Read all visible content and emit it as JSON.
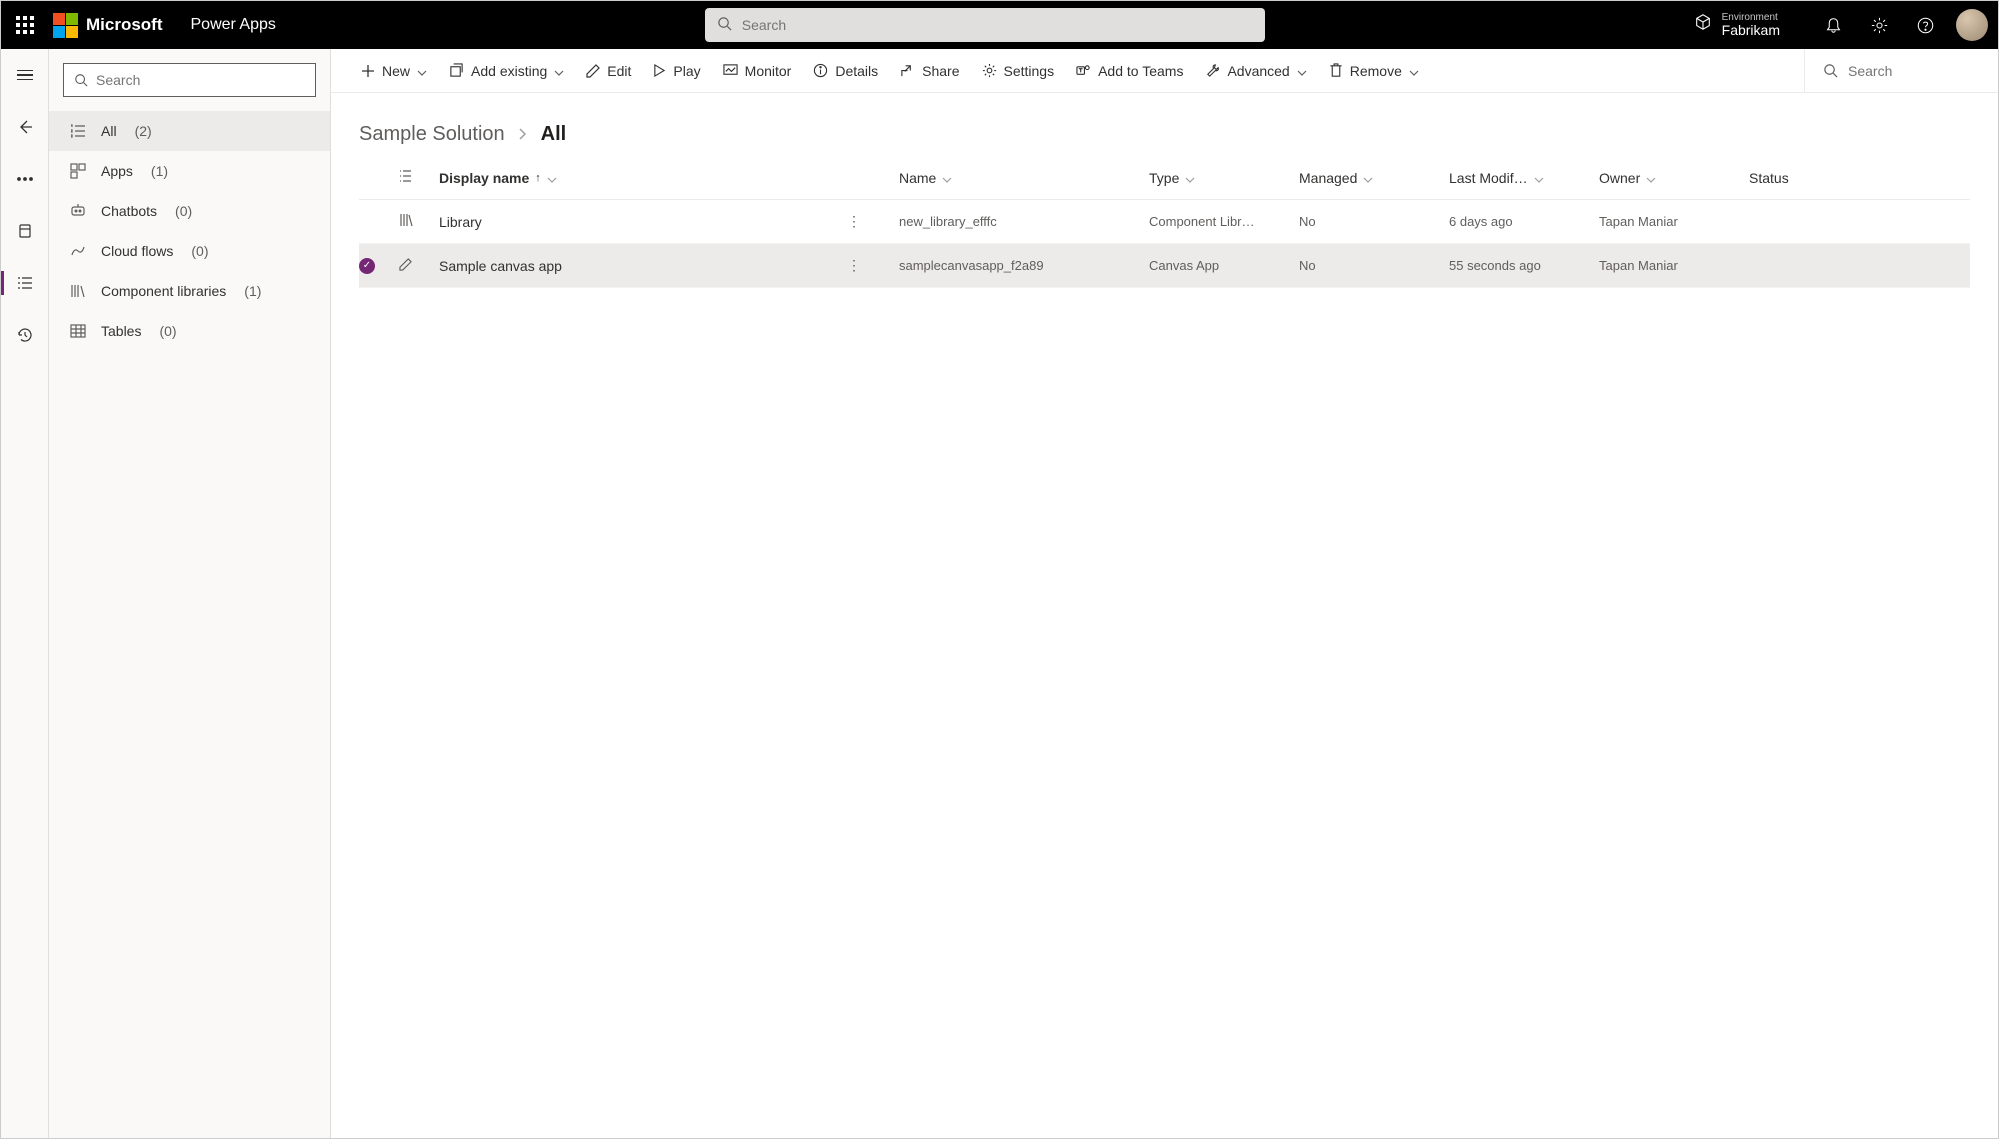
{
  "topbar": {
    "ms_text": "Microsoft",
    "app_name": "Power Apps",
    "search_placeholder": "Search",
    "env_label": "Environment",
    "env_value": "Fabrikam"
  },
  "sidebar": {
    "search_placeholder": "Search",
    "items": [
      {
        "label": "All",
        "count": "(2)",
        "selected": true
      },
      {
        "label": "Apps",
        "count": "(1)",
        "selected": false
      },
      {
        "label": "Chatbots",
        "count": "(0)",
        "selected": false
      },
      {
        "label": "Cloud flows",
        "count": "(0)",
        "selected": false
      },
      {
        "label": "Component libraries",
        "count": "(1)",
        "selected": false
      },
      {
        "label": "Tables",
        "count": "(0)",
        "selected": false
      }
    ]
  },
  "commandbar": {
    "new": "New",
    "add_existing": "Add existing",
    "edit": "Edit",
    "play": "Play",
    "monitor": "Monitor",
    "details": "Details",
    "share": "Share",
    "settings": "Settings",
    "add_to_teams": "Add to Teams",
    "advanced": "Advanced",
    "remove": "Remove",
    "search_placeholder": "Search"
  },
  "breadcrumb": {
    "parent": "Sample Solution",
    "current": "All"
  },
  "table": {
    "columns": {
      "display_name": "Display name",
      "name": "Name",
      "type": "Type",
      "managed": "Managed",
      "last_modified": "Last Modif…",
      "owner": "Owner",
      "status": "Status"
    },
    "rows": [
      {
        "selected": false,
        "display_name": "Library",
        "name": "new_library_efffc",
        "type": "Component Libr…",
        "managed": "No",
        "last_modified": "6 days ago",
        "owner": "Tapan Maniar",
        "status": ""
      },
      {
        "selected": true,
        "display_name": "Sample canvas app",
        "name": "samplecanvasapp_f2a89",
        "type": "Canvas App",
        "managed": "No",
        "last_modified": "55 seconds ago",
        "owner": "Tapan Maniar",
        "status": ""
      }
    ]
  }
}
